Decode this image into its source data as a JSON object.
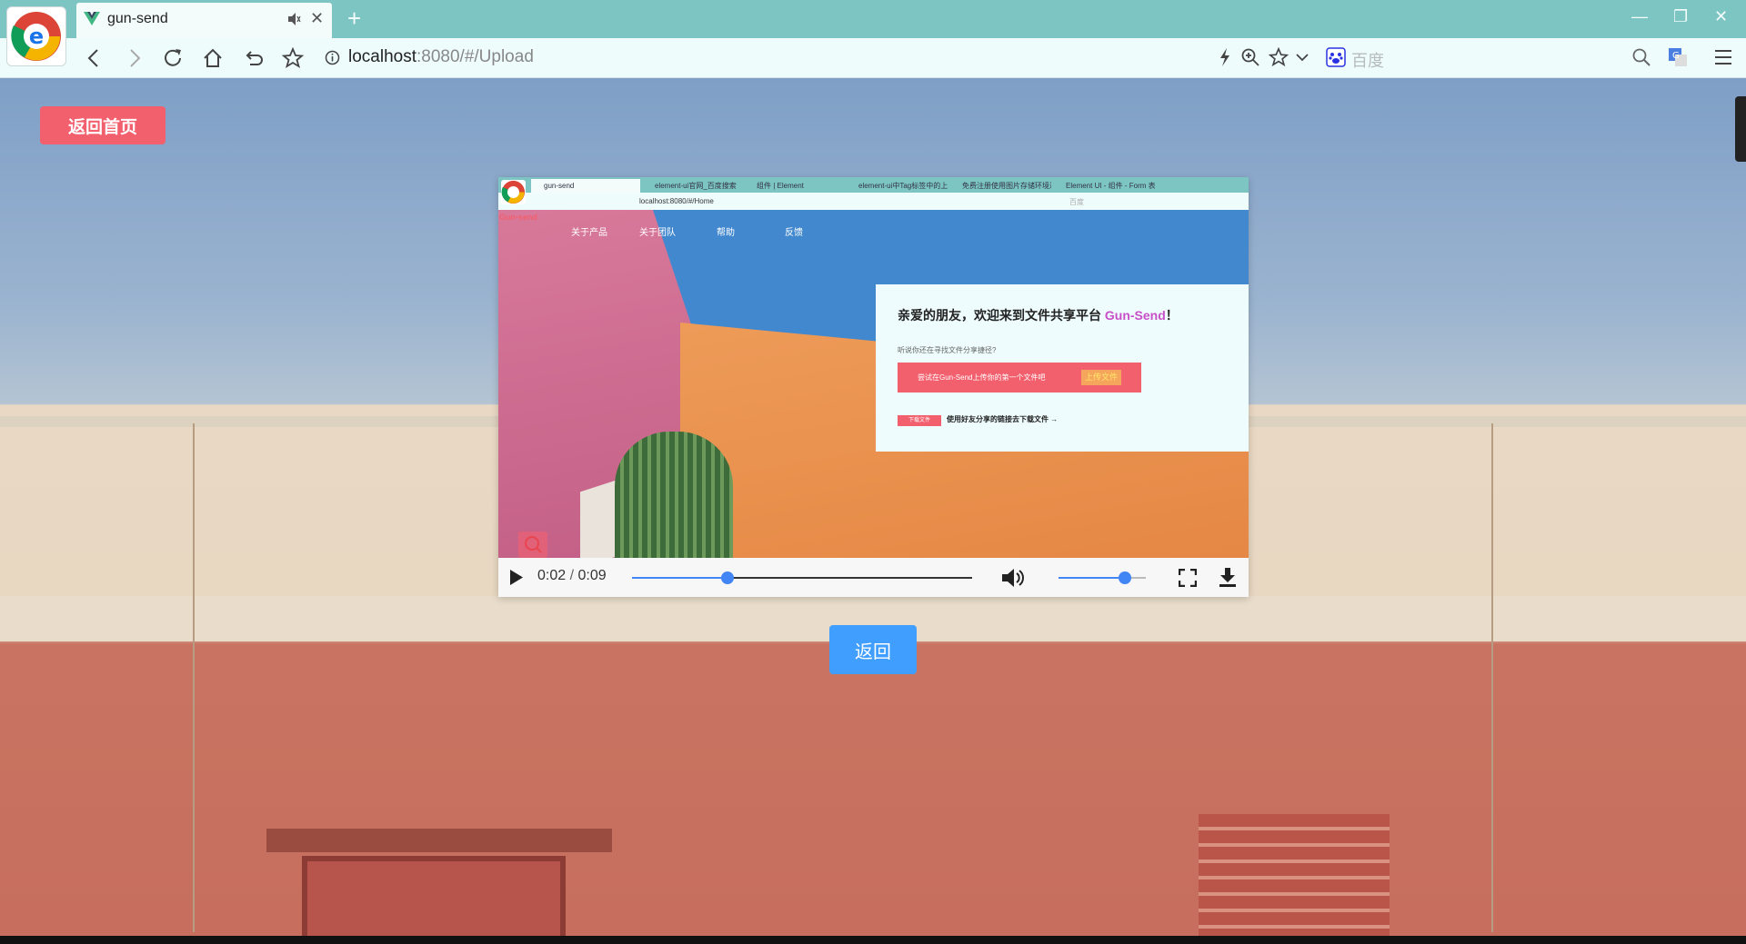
{
  "browser": {
    "tab_title": "gun-send",
    "address_host": "localhost",
    "address_rest": ":8080/#/Upload",
    "search_placeholder": "百度"
  },
  "page": {
    "home_button": "返回首页",
    "back_button": "返回"
  },
  "video": {
    "current_time": "0:02",
    "duration": "0:09",
    "progress": 0.28,
    "volume": 0.76,
    "frame": {
      "tabs": [
        "gun-send",
        "element-ui官网_百度搜索",
        "组件 | Element",
        "element-ui中Tag标签中的上传",
        "免费注册使用图片存储环境过滤...",
        "Element UI - 组件 - Form 表单"
      ],
      "address": "localhost:8080/#/Home",
      "search_placeholder": "百度",
      "brand": "Gun-send",
      "nav": [
        "关于产品",
        "关于团队",
        "帮助",
        "反馈"
      ],
      "card": {
        "heading_prefix": "亲爱的朋友，欢迎来到文件共享平台 ",
        "heading_brand": "Gun-Send",
        "heading_suffix": "！",
        "subtitle": "听说你还在寻找文件分享捷径?",
        "upload_text": "尝试在Gun-Send上传你的第一个文件吧",
        "upload_button": "上传文件",
        "download_button": "下载文件",
        "download_text": "使用好友分享的链接去下载文件 →"
      }
    }
  }
}
